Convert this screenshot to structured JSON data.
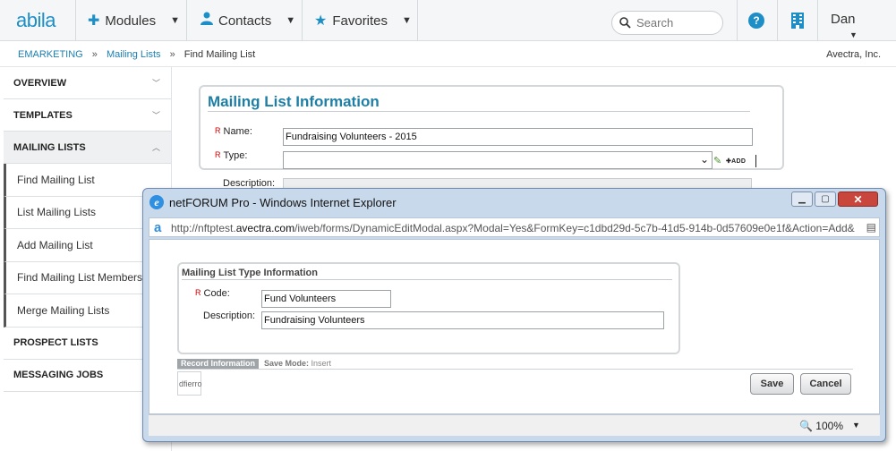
{
  "app": {
    "logo": "abila",
    "nav": [
      {
        "label": "Modules",
        "icon": "puzzle-icon",
        "glyph": "✚"
      },
      {
        "label": "Contacts",
        "icon": "person-icon",
        "glyph": "👤"
      },
      {
        "label": "Favorites",
        "icon": "star-icon",
        "glyph": "★"
      }
    ],
    "search_placeholder": "Search",
    "help_glyph": "?",
    "user": "Dan"
  },
  "breadcrumb": {
    "items": [
      "EMARKETING",
      "Mailing Lists",
      "Find Mailing List"
    ],
    "separator": "»",
    "org": "Avectra, Inc."
  },
  "sidebar": {
    "sections_top": [
      {
        "label": "OVERVIEW",
        "chevron": "﹀"
      },
      {
        "label": "TEMPLATES",
        "chevron": "﹀"
      },
      {
        "label": "MAILING LISTS",
        "chevron": "︿"
      }
    ],
    "items": [
      "Find Mailing List",
      "List Mailing Lists",
      "Add Mailing List",
      "Find Mailing List Members",
      "Merge Mailing Lists"
    ],
    "sections_bottom": [
      "PROSPECT LISTS",
      "MESSAGING JOBS"
    ]
  },
  "mailing_list_info": {
    "title": "Mailing List Information",
    "required_marker": "R",
    "name_label": "Name:",
    "name_value": "Fundraising Volunteers - 2015",
    "type_label": "Type:",
    "type_value": "",
    "add_label": "ADD",
    "description_label": "Description:"
  },
  "dialog": {
    "title": "netFORUM Pro - Windows Internet Explorer",
    "url_prefix": "http://nftptest.",
    "url_domain": "avectra.com",
    "url_rest": "/iweb/forms/DynamicEditModal.aspx?Modal=Yes&FormKey=c1dbd29d-5c7b-41d5-914b-0d57609e0e1f&Action=Add&",
    "section_title": "Mailing List Type Information",
    "required_marker": "R",
    "code_label": "Code:",
    "code_value": "Fund Volunteers",
    "description_label": "Description:",
    "description_value": "Fundraising Volunteers",
    "record_tab": "Record Information",
    "save_mode_label": "Save Mode:",
    "save_mode_value": "Insert",
    "record_user": "dfierro",
    "save_button": "Save",
    "cancel_button": "Cancel",
    "zoom": "100%"
  },
  "colors": {
    "brand": "#1d8fc6",
    "title_teal": "#1e7fa6",
    "required": "#cc0000"
  }
}
